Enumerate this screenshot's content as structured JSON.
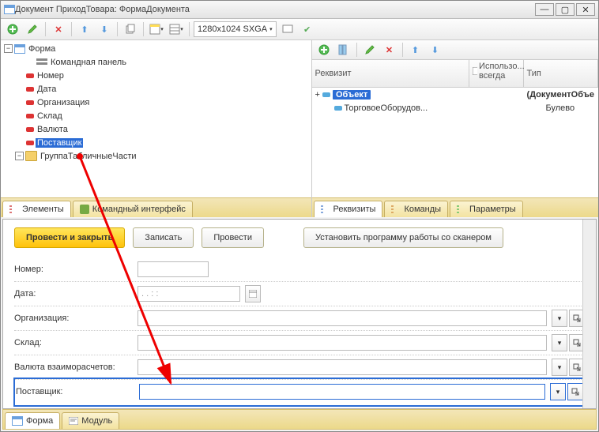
{
  "window": {
    "title": "Документ ПриходТовара: ФормаДокумента"
  },
  "toolbar": {
    "resolution": "1280x1024 SXGA"
  },
  "tree": {
    "root": "Форма",
    "items": [
      {
        "label": "Командная панель",
        "color": "#888"
      },
      {
        "label": "Номер",
        "color": "#d33"
      },
      {
        "label": "Дата",
        "color": "#d33"
      },
      {
        "label": "Организация",
        "color": "#d33"
      },
      {
        "label": "Склад",
        "color": "#d33"
      },
      {
        "label": "Валюта",
        "color": "#d33"
      },
      {
        "label": "Поставщик",
        "color": "#d33",
        "selected": true
      }
    ],
    "group": "ГруппаТабличныеЧасти"
  },
  "left_tabs": [
    "Элементы",
    "Командный интерфейс"
  ],
  "right_tabs": [
    "Реквизиты",
    "Команды",
    "Параметры"
  ],
  "grid": {
    "headers": [
      "Реквизит",
      "Использо... всегда",
      "Тип"
    ],
    "rows": [
      {
        "name": "Объект",
        "type": "(ДокументОбъе",
        "bold": true
      },
      {
        "name": "ТорговоеОборудов...",
        "type": "Булево"
      }
    ]
  },
  "preview": {
    "buttons": [
      "Провести и закрыть",
      "Записать",
      "Провести",
      "Установить программу работы со сканером"
    ],
    "fields": [
      {
        "label": "Номер:",
        "kind": "text"
      },
      {
        "label": "Дата:",
        "kind": "date",
        "placeholder": ".   .        :   :"
      },
      {
        "label": "Организация:",
        "kind": "ref"
      },
      {
        "label": "Склад:",
        "kind": "ref"
      },
      {
        "label": "Валюта взаиморасчетов:",
        "kind": "ref"
      },
      {
        "label": "Поставщик:",
        "kind": "ref",
        "highlighted": true
      }
    ]
  },
  "bottom_tabs": [
    "Форма",
    "Модуль"
  ]
}
